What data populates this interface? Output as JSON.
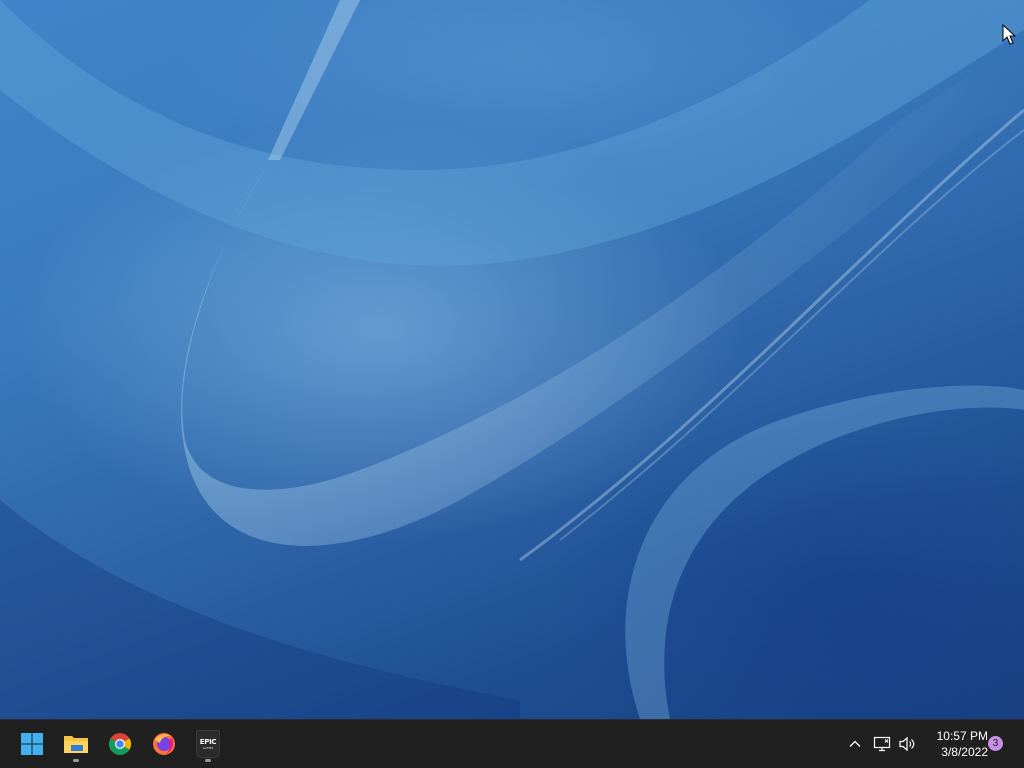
{
  "desktop": {
    "wallpaper": "blue-flow-wallpaper"
  },
  "taskbar": {
    "background": "#202020",
    "pinned": [
      {
        "name": "start-button",
        "icon": "windows-logo-icon",
        "running": false
      },
      {
        "name": "file-explorer-button",
        "icon": "folder-icon",
        "running": true
      },
      {
        "name": "chrome-button",
        "icon": "chrome-icon",
        "running": false
      },
      {
        "name": "firefox-button",
        "icon": "firefox-icon",
        "running": false
      },
      {
        "name": "epic-games-button",
        "icon": "epic-games-icon",
        "running": true
      }
    ],
    "epic_logo_text": "EPIC",
    "epic_logo_subtext": "GAMES"
  },
  "tray": {
    "icons": [
      "chevron-up-icon",
      "network-icon",
      "volume-icon"
    ],
    "time": "10:57 PM",
    "date": "3/8/2022",
    "notification_count": "3",
    "badge_color": "#c88fe8"
  }
}
